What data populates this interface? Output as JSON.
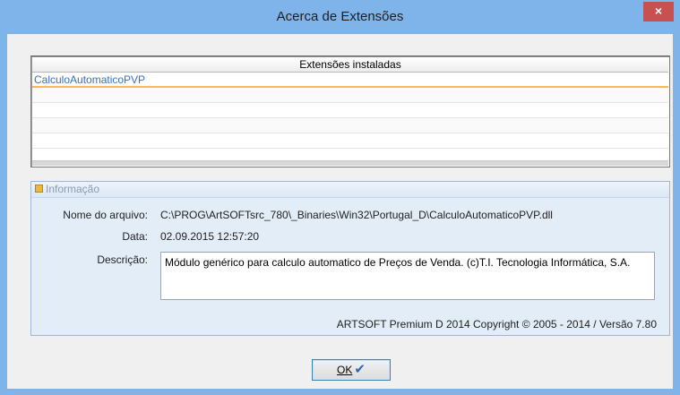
{
  "window": {
    "title": "Acerca de Extensões",
    "close_glyph": "×"
  },
  "extensions": {
    "header": "Extensões instaladas",
    "items": [
      "CalculoAutomaticoPVP",
      "",
      "",
      "",
      ""
    ]
  },
  "info": {
    "legend": "Informação",
    "file_label": "Nome do arquivo:",
    "file_value": "C:\\PROG\\ArtSOFTsrc_780\\_Binaries\\Win32\\Portugal_D\\CalculoAutomaticoPVP.dll",
    "date_label": "Data:",
    "date_value": "02.09.2015 12:57:20",
    "desc_label": "Descrição:",
    "desc_value": "Módulo genérico para calculo automatico de Preços de Venda. (c)T.I. Tecnologia Informática, S.A.",
    "copyright": "ARTSOFT Premium D 2014 Copyright © 2005 - 2014 / Versão 7.80"
  },
  "buttons": {
    "ok_label": "OK",
    "ok_icon": "✔"
  },
  "colors": {
    "titlebar": "#7eb4ea",
    "close": "#c75050",
    "selection_text": "#3a6fc0",
    "info_bg": "#e3edf8"
  }
}
